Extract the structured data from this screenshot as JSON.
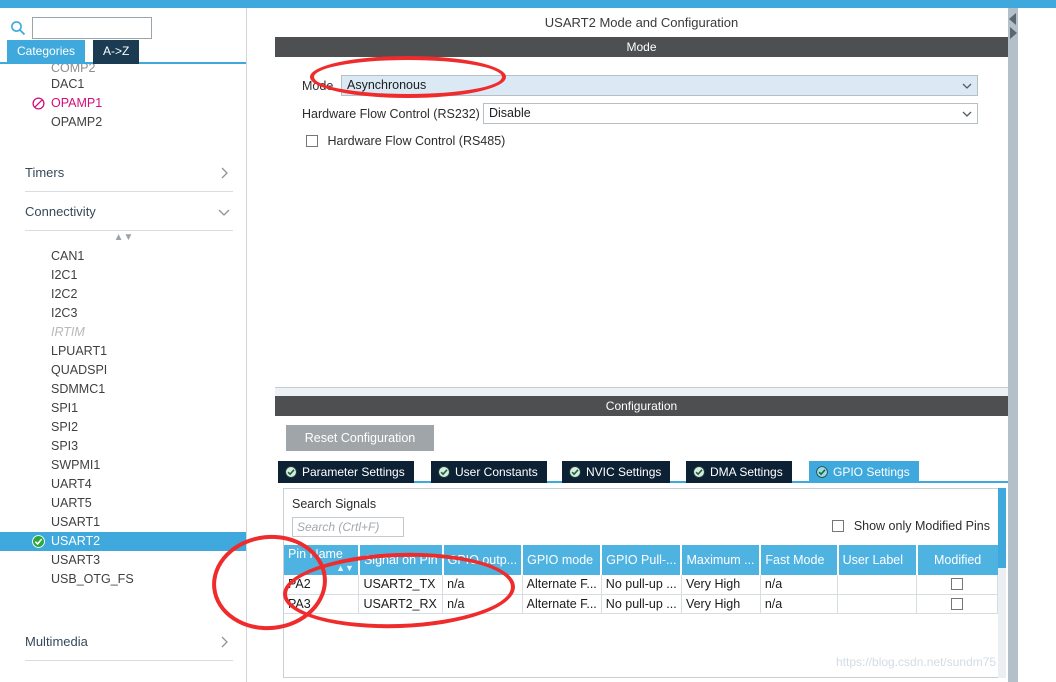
{
  "left_panel": {
    "search": {
      "value": "",
      "placeholder": ""
    },
    "gear_icon": "gear-icon",
    "tabs": [
      {
        "label": "Categories",
        "active": true
      },
      {
        "label": "A->Z",
        "active": false
      }
    ],
    "top_partial_item": "COMP2",
    "peripherals_top": [
      {
        "label": "DAC1",
        "state": "normal"
      },
      {
        "label": "OPAMP1",
        "state": "warning"
      },
      {
        "label": "OPAMP2",
        "state": "normal"
      }
    ],
    "groups": [
      {
        "label": "Timers",
        "expanded": false,
        "chevron": "chevron-right-icon"
      },
      {
        "label": "Connectivity",
        "expanded": true,
        "chevron": "chevron-down-icon"
      },
      {
        "label": "Multimedia",
        "expanded": false,
        "chevron": "chevron-right-icon"
      }
    ],
    "connectivity_items": [
      {
        "label": "CAN1",
        "state": "normal"
      },
      {
        "label": "I2C1",
        "state": "normal"
      },
      {
        "label": "I2C2",
        "state": "normal"
      },
      {
        "label": "I2C3",
        "state": "normal"
      },
      {
        "label": "IRTIM",
        "state": "disabled"
      },
      {
        "label": "LPUART1",
        "state": "normal"
      },
      {
        "label": "QUADSPI",
        "state": "normal"
      },
      {
        "label": "SDMMC1",
        "state": "normal"
      },
      {
        "label": "SPI1",
        "state": "normal"
      },
      {
        "label": "SPI2",
        "state": "normal"
      },
      {
        "label": "SPI3",
        "state": "normal"
      },
      {
        "label": "SWPMI1",
        "state": "normal"
      },
      {
        "label": "UART4",
        "state": "normal"
      },
      {
        "label": "UART5",
        "state": "normal"
      },
      {
        "label": "USART1",
        "state": "normal"
      },
      {
        "label": "USART2",
        "state": "selected-enabled"
      },
      {
        "label": "USART3",
        "state": "normal"
      },
      {
        "label": "USB_OTG_FS",
        "state": "normal"
      }
    ]
  },
  "right_panel": {
    "title": "USART2 Mode and Configuration",
    "mode_section": {
      "header": "Mode",
      "mode_label": "Mode",
      "mode_value": "Asynchronous",
      "flow_label": "Hardware Flow Control (RS232)",
      "flow_value": "Disable",
      "rs485_label": "Hardware Flow Control (RS485)",
      "rs485_checked": false
    },
    "configuration_section": {
      "header": "Configuration",
      "reset_button": "Reset Configuration",
      "tabs": [
        {
          "label": "Parameter Settings",
          "active": false
        },
        {
          "label": "User Constants",
          "active": false
        },
        {
          "label": "NVIC Settings",
          "active": false
        },
        {
          "label": "DMA Settings",
          "active": false
        },
        {
          "label": "GPIO Settings",
          "active": true
        }
      ],
      "search_signals_label": "Search Signals",
      "search_placeholder": "Search (Crtl+F)",
      "show_modified_label": "Show only Modified Pins",
      "show_modified_checked": false,
      "table": {
        "columns": [
          "Pin Name",
          "Signal on Pin",
          "GPIO outp...",
          "GPIO mode",
          "GPIO Pull-...",
          "Maximum ...",
          "Fast Mode",
          "User Label",
          "Modified"
        ],
        "sorted_column": "Pin Name",
        "rows": [
          {
            "pin_name": "PA2",
            "signal_on_pin": "USART2_TX",
            "gpio_output": "n/a",
            "gpio_mode": "Alternate F...",
            "gpio_pull": "No pull-up ...",
            "maximum": "Very High",
            "fast_mode": "n/a",
            "user_label": "",
            "modified": false
          },
          {
            "pin_name": "PA3",
            "signal_on_pin": "USART2_RX",
            "gpio_output": "n/a",
            "gpio_mode": "Alternate F...",
            "gpio_pull": "No pull-up ...",
            "maximum": "Very High",
            "fast_mode": "n/a",
            "user_label": "",
            "modified": false
          }
        ]
      }
    }
  },
  "watermark": "https://blog.csdn.net/sundm75",
  "colors": {
    "accent_blue": "#3fa9dd",
    "table_header_blue": "#4fb3e2",
    "dark_tab": "#0d2135",
    "section_bar": "#4d4f51",
    "warning_pink": "#d10f7a",
    "annotation_red": "#ef2b2b",
    "enabled_green": "#2aa83e"
  }
}
